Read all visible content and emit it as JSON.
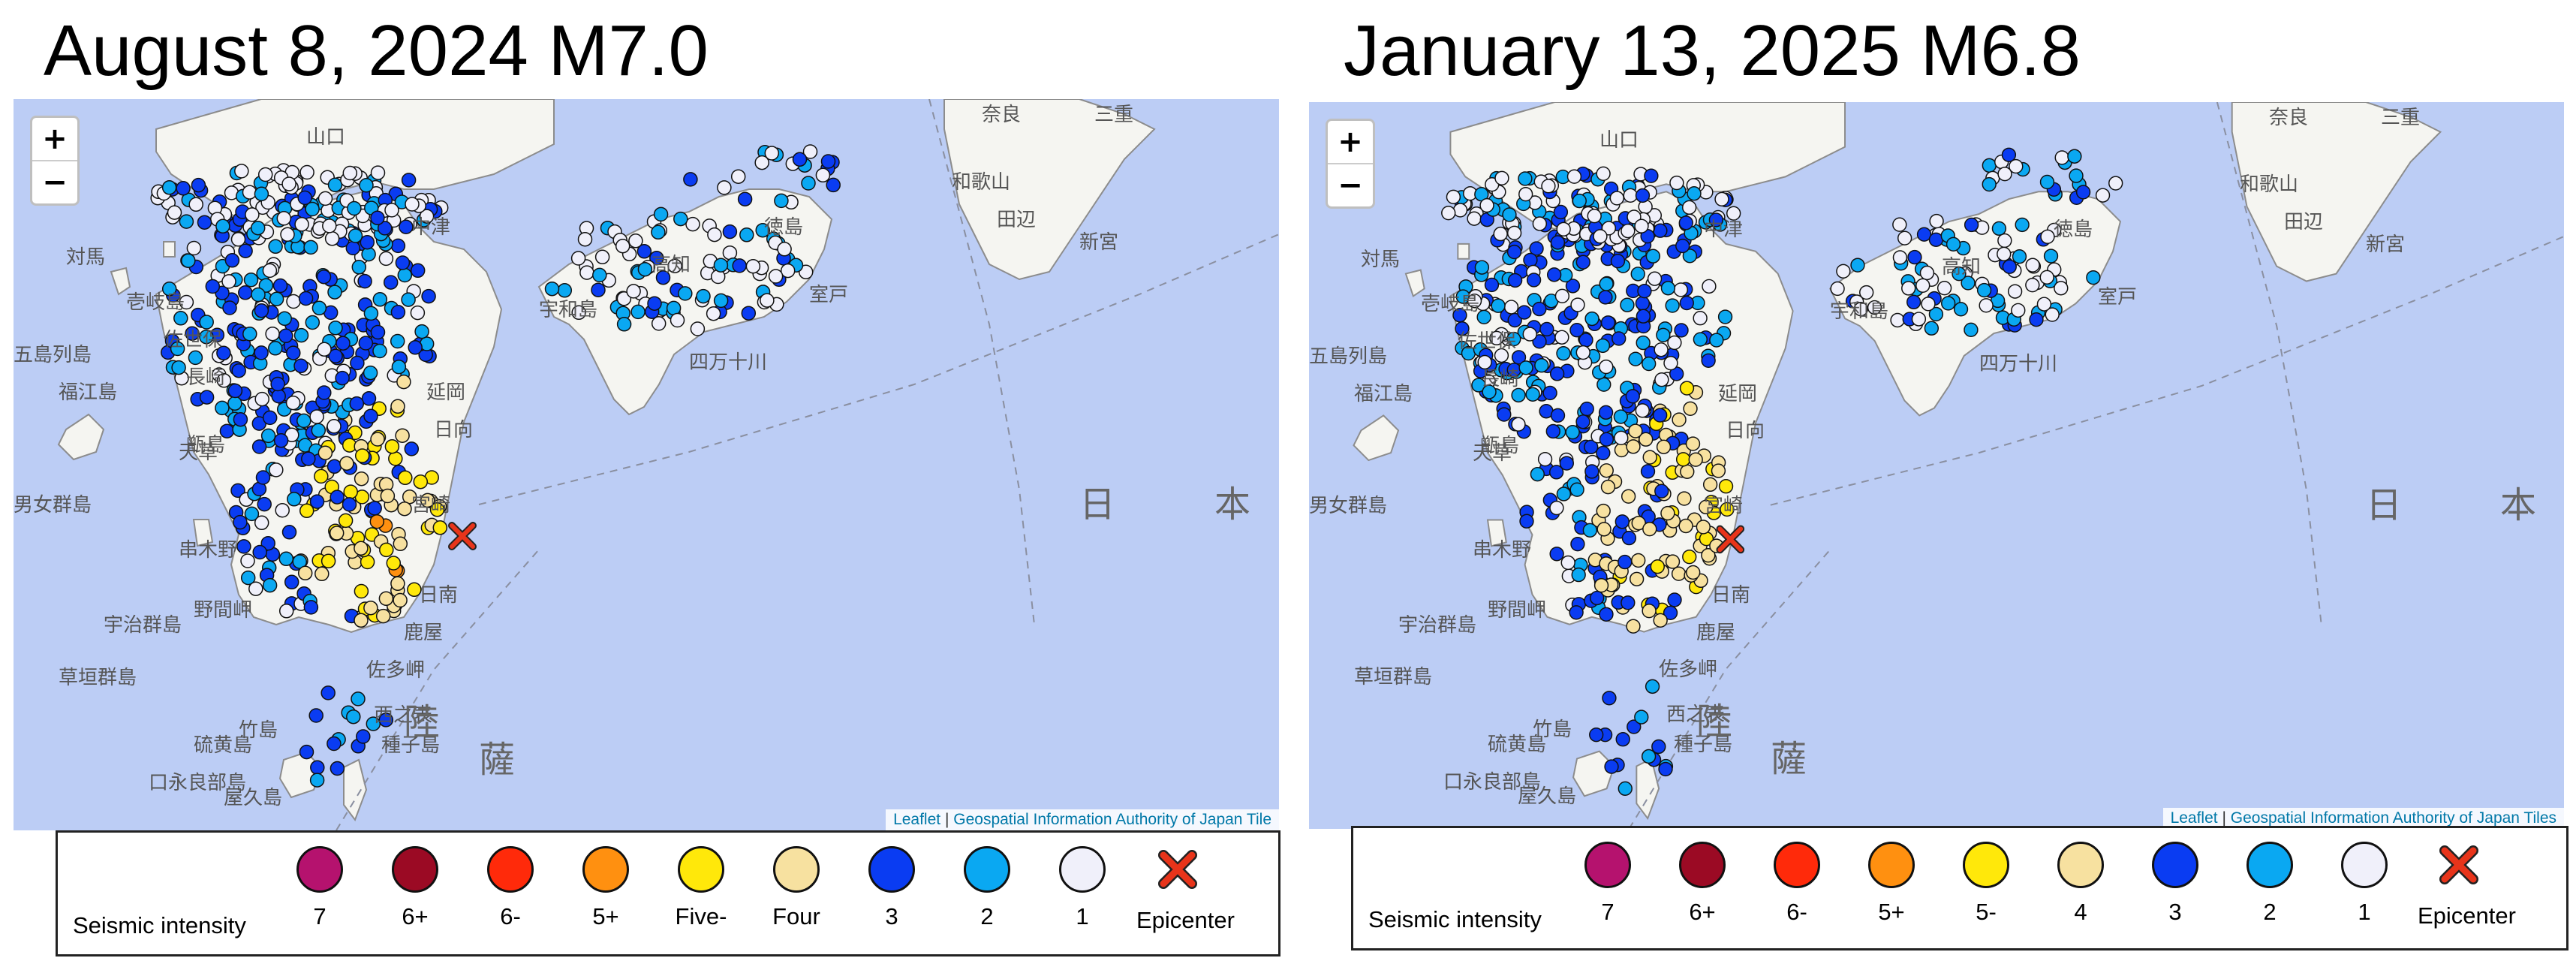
{
  "panels": [
    {
      "title": "August 8, 2024 M7.0",
      "attribution_leaflet": "Leaflet",
      "attribution_sep": " | ",
      "attribution_source": "Geospatial Information Authority of Japan Tile",
      "legend": {
        "title": "Seismic intensity",
        "items": [
          {
            "label": "7",
            "color": "#b5126e"
          },
          {
            "label": "6+",
            "color": "#9b0a24"
          },
          {
            "label": "6-",
            "color": "#ff2a0a"
          },
          {
            "label": "5+",
            "color": "#ff9010"
          },
          {
            "label": "Five-",
            "color": "#ffe80a"
          },
          {
            "label": "Four",
            "color": "#f7e1a0"
          },
          {
            "label": "3",
            "color": "#0a3cf2"
          },
          {
            "label": "2",
            "color": "#0aa8f2"
          },
          {
            "label": "1",
            "color": "#f0f0fa"
          },
          {
            "label": "Epicenter",
            "color": "#e8341a",
            "icon": "x-mark-icon"
          }
        ]
      },
      "places": [
        "対馬",
        "壱岐島",
        "五島列島",
        "福江島",
        "甑島",
        "男女群島",
        "宇治群島",
        "草垣群島",
        "硫黄島",
        "竹島",
        "口永良部島",
        "屋久島",
        "西之表",
        "種子島",
        "徳島",
        "和歌山",
        "奈良",
        "三重",
        "田辺",
        "新宮",
        "室戸",
        "高知",
        "宮崎",
        "日向",
        "延岡",
        "日南",
        "鹿屋",
        "野間岬",
        "串木野",
        "佐多岬",
        "天草",
        "長崎",
        "佐世保",
        "宇和島",
        "中津",
        "山口",
        "四万十川",
        "日",
        "本",
        "薩",
        "陸"
      ]
    },
    {
      "title": "January 13, 2025 M6.8",
      "attribution_leaflet": "Leaflet",
      "attribution_sep": " | ",
      "attribution_source": "Geospatial Information Authority of Japan Tiles",
      "legend": {
        "title": "Seismic intensity",
        "items": [
          {
            "label": "7",
            "color": "#b5126e"
          },
          {
            "label": "6+",
            "color": "#9b0a24"
          },
          {
            "label": "6-",
            "color": "#ff2a0a"
          },
          {
            "label": "5+",
            "color": "#ff9010"
          },
          {
            "label": "5-",
            "color": "#ffe80a"
          },
          {
            "label": "4",
            "color": "#f7e1a0"
          },
          {
            "label": "3",
            "color": "#0a3cf2"
          },
          {
            "label": "2",
            "color": "#0aa8f2"
          },
          {
            "label": "1",
            "color": "#f0f0fa"
          },
          {
            "label": "Epicenter",
            "color": "#e8341a",
            "icon": "x-mark-icon"
          }
        ]
      },
      "places": [
        "対馬",
        "壱岐島",
        "五島列島",
        "福江島",
        "甑島",
        "男女群島",
        "宇治群島",
        "草垣群島",
        "硫黄島",
        "竹島",
        "口永良部島",
        "屋久島",
        "西之表",
        "種子島",
        "徳島",
        "和歌山",
        "奈良",
        "三重",
        "田辺",
        "新宮",
        "室戸",
        "高知",
        "宮崎",
        "日向",
        "延岡",
        "日南",
        "鹿屋",
        "野間岬",
        "串木野",
        "佐多岬",
        "天草",
        "長崎",
        "佐世保",
        "宇和島",
        "中津",
        "山口",
        "四万十川",
        "日",
        "本",
        "薩",
        "陸"
      ]
    }
  ],
  "zoom_in_label": "+",
  "zoom_out_label": "−",
  "colors": {
    "sea": "#bccdf5",
    "land": "#f6f6f3",
    "coast": "#8a8a8a"
  }
}
